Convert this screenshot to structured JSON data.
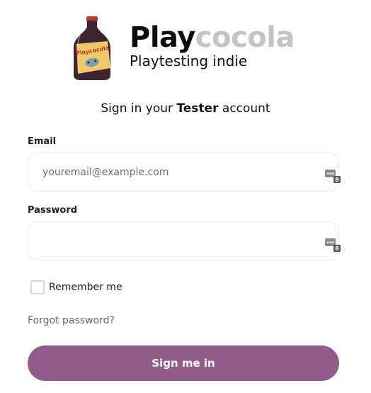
{
  "brand": {
    "name_part1": "Play",
    "name_part2": "cocola",
    "tagline": "Playtesting indie",
    "bottle_label": "Playcocola"
  },
  "heading": {
    "prefix": "Sign in your",
    "emphasis": "Tester",
    "suffix": "account"
  },
  "form": {
    "email_label": "Email",
    "email_placeholder": "youremail@example.com",
    "email_value": "",
    "password_label": "Password",
    "password_value": "",
    "password_manager_badge": "8",
    "remember_label": "Remember me",
    "remember_checked": false,
    "forgot_link": "Forgot password?",
    "submit_label": "Sign me in"
  },
  "colors": {
    "accent": "#925c88",
    "link": "#7d5878",
    "brand_secondary": "#c4c4c4"
  },
  "icons": {
    "logo": "soda-bottle-icon",
    "password_manager": "password-manager-icon",
    "checkbox": "checkbox-unchecked"
  }
}
